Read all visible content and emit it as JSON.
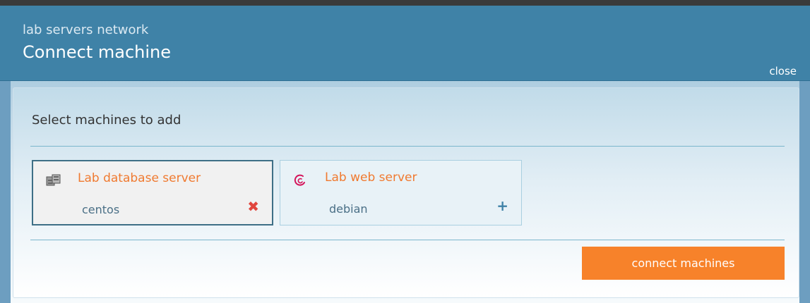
{
  "dialog": {
    "network_name": "lab servers network",
    "title": "Connect machine",
    "close_label": "close"
  },
  "section": {
    "title": "Select machines to add"
  },
  "machines": [
    {
      "name": "Lab database server",
      "os": "centos",
      "icon": "server-icon",
      "selected": true,
      "action_symbol": "✖",
      "action": "remove"
    },
    {
      "name": "Lab web server",
      "os": "debian",
      "icon": "debian-swirl-icon",
      "selected": false,
      "action_symbol": "+",
      "action": "add"
    }
  ],
  "footer": {
    "connect_label": "connect machines"
  },
  "colors": {
    "header_bg": "#3f82a7",
    "accent_orange": "#f7822a",
    "machine_name": "#f07a30",
    "remove_red": "#e0453d"
  }
}
